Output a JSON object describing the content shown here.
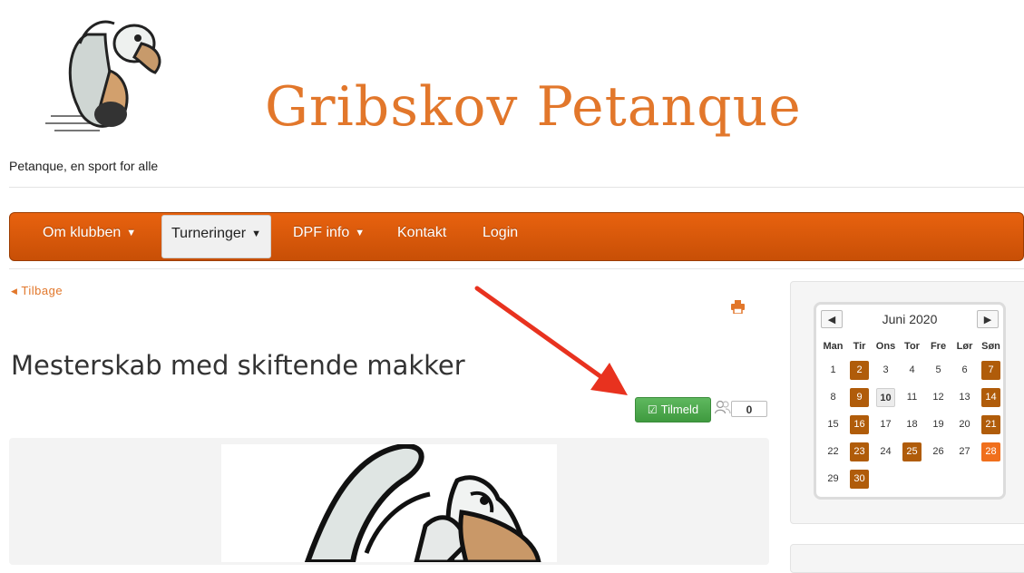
{
  "site": {
    "title": "Gribskov Petanque",
    "tagline": "Petanque, en sport for alle",
    "logo_icon": "vulture-mascot-logo"
  },
  "nav": {
    "items": [
      {
        "label": "Om klubben",
        "dropdown": true,
        "active": false
      },
      {
        "label": "Turneringer",
        "dropdown": true,
        "active": true
      },
      {
        "label": "DPF info",
        "dropdown": true,
        "active": false
      },
      {
        "label": "Kontakt",
        "dropdown": false,
        "active": false
      },
      {
        "label": "Login",
        "dropdown": false,
        "active": false
      }
    ],
    "bar_color": "#d85a0a"
  },
  "back_link": "Tilbage",
  "event": {
    "title": "Mesterskab med skiftende makker",
    "signup_label": "Tilmeld",
    "participant_count": "0",
    "signup_color": "#4cae4c"
  },
  "calendar": {
    "month_label": "Juni 2020",
    "weekdays": [
      "Man",
      "Tir",
      "Ons",
      "Tor",
      "Fre",
      "Lør",
      "Søn"
    ],
    "weeks": [
      [
        "1",
        "2",
        "3",
        "4",
        "5",
        "6",
        "7"
      ],
      [
        "8",
        "9",
        "10",
        "11",
        "12",
        "13",
        "14"
      ],
      [
        "15",
        "16",
        "17",
        "18",
        "19",
        "20",
        "21"
      ],
      [
        "22",
        "23",
        "24",
        "25",
        "26",
        "27",
        "28"
      ],
      [
        "29",
        "30",
        "",
        "",
        "",
        "",
        ""
      ]
    ],
    "event_days": [
      "2",
      "7",
      "9",
      "14",
      "16",
      "21",
      "23",
      "25",
      "30"
    ],
    "highlight_days": [
      "28"
    ],
    "today": "10",
    "event_color": "#b05c0a",
    "highlight_color": "#f06f1c"
  }
}
